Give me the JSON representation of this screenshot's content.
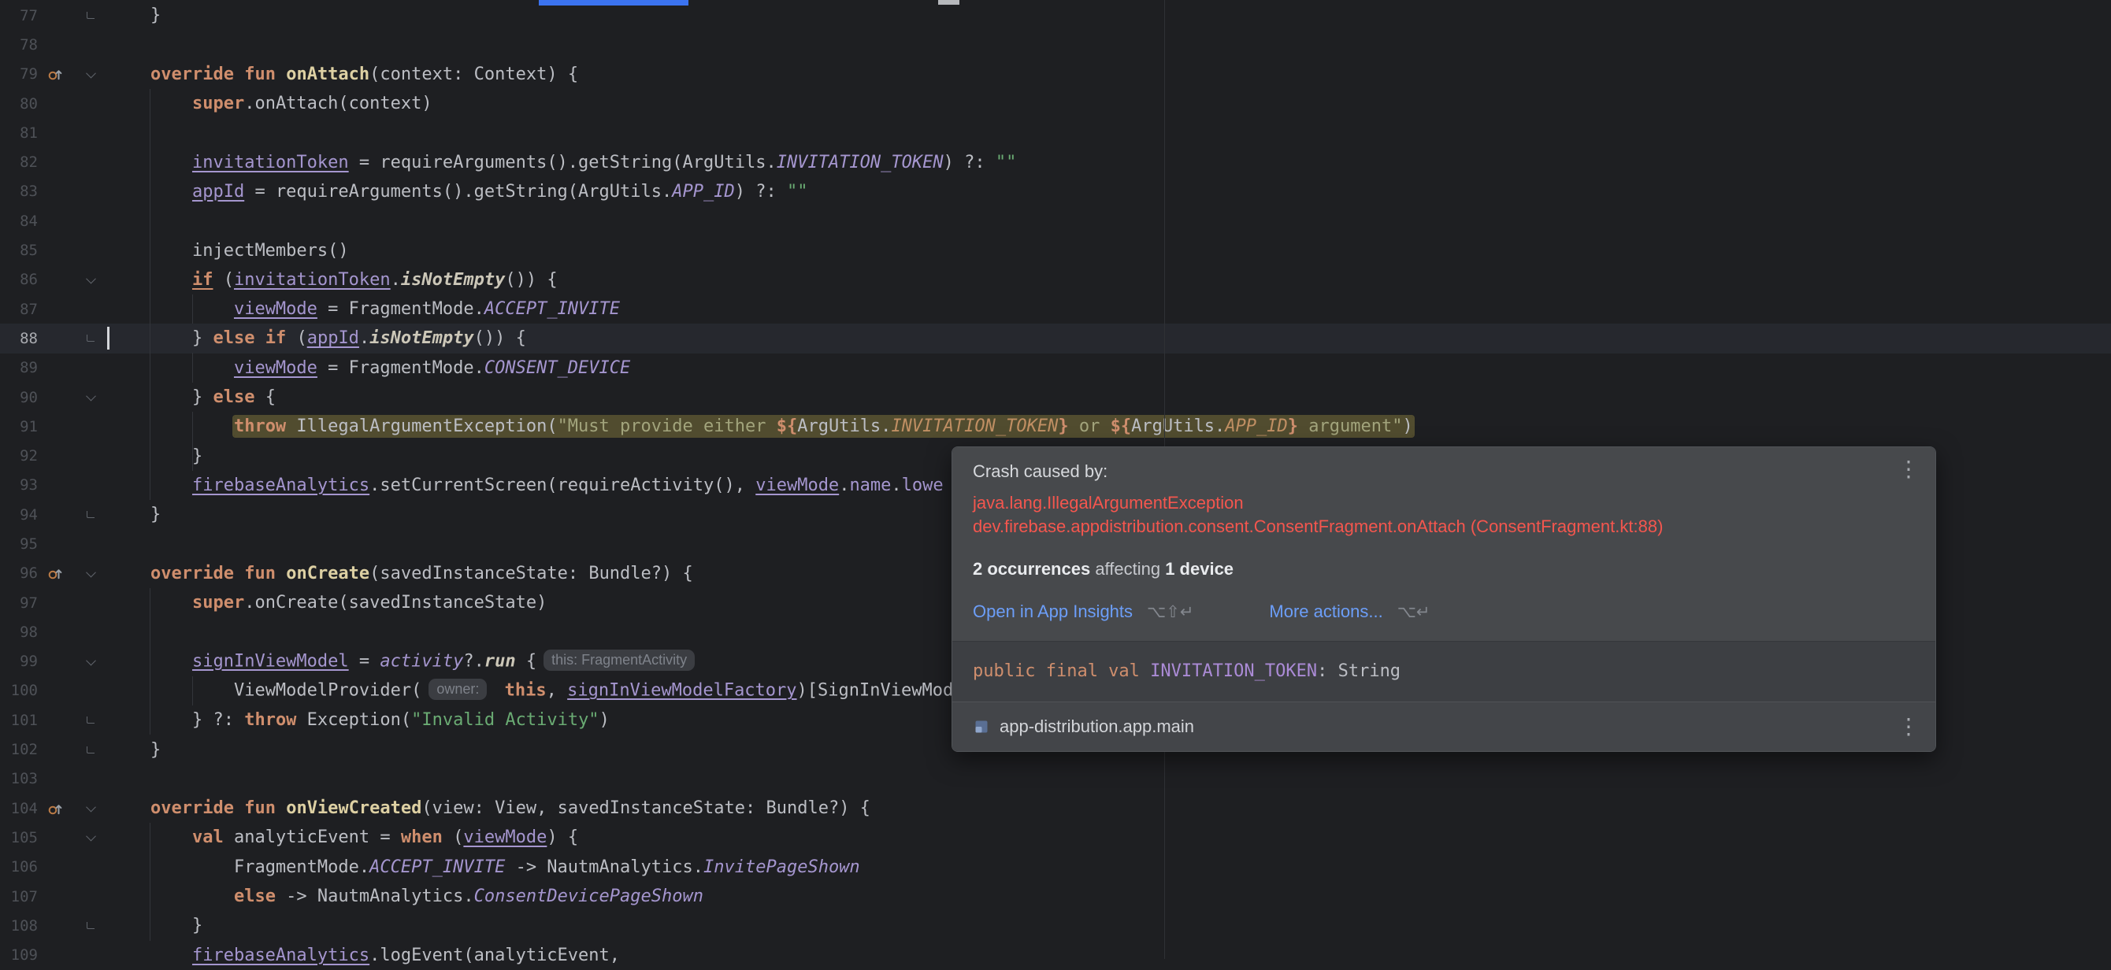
{
  "colors": {
    "editor_bg": "#1e1f22",
    "caret_line_bg": "#26282e",
    "crash_line_bg": "#514c2f",
    "error_red": "#f4564e",
    "link_blue": "#6c9ef8",
    "keyword_orange": "#cf8e6d",
    "string_green": "#6aab73",
    "property_purple": "#a596cf",
    "tab_indicator_blue": "#3b73f0"
  },
  "editor": {
    "caret": {
      "line": 88,
      "col": 0
    },
    "lines": [
      {
        "n": 77,
        "ind": 4,
        "fold": "end",
        "tokens": [
          [
            "}",
            "d"
          ]
        ]
      },
      {
        "n": 78
      },
      {
        "n": 79,
        "ind": 4,
        "icon": "override",
        "fold": "open",
        "tokens": [
          [
            "override",
            "k"
          ],
          [
            " ",
            "d"
          ],
          [
            "fun",
            "k"
          ],
          [
            " ",
            "d"
          ],
          [
            "onAttach",
            "f"
          ],
          [
            "(context: Context) {",
            "d"
          ]
        ]
      },
      {
        "n": 80,
        "ind": 8,
        "tokens": [
          [
            "super",
            "k"
          ],
          [
            ".onAttach(context)",
            "d"
          ]
        ]
      },
      {
        "n": 81
      },
      {
        "n": 82,
        "ind": 8,
        "tokens": [
          [
            "invitationToken",
            "p"
          ],
          [
            " = requireArguments().getString(ArgUtils.",
            "d"
          ],
          [
            "INVITATION_TOKEN",
            "c"
          ],
          [
            ") ?: ",
            "d"
          ],
          [
            "\"\"",
            "s"
          ]
        ]
      },
      {
        "n": 83,
        "ind": 8,
        "tokens": [
          [
            "appId",
            "p"
          ],
          [
            " = requireArguments().getString(ArgUtils.",
            "d"
          ],
          [
            "APP_ID",
            "c"
          ],
          [
            ") ?: ",
            "d"
          ],
          [
            "\"\"",
            "s"
          ]
        ]
      },
      {
        "n": 84
      },
      {
        "n": 85,
        "ind": 8,
        "tokens": [
          [
            "injectMembers()",
            "d"
          ]
        ]
      },
      {
        "n": 86,
        "ind": 8,
        "fold": "open",
        "tokens": [
          [
            "if",
            "ku"
          ],
          [
            " (",
            "d"
          ],
          [
            "invitationToken",
            "p"
          ],
          [
            ".",
            "d"
          ],
          [
            "isNotEmpty",
            "dbi"
          ],
          [
            "()) {",
            "d"
          ]
        ]
      },
      {
        "n": 87,
        "ind": 12,
        "tokens": [
          [
            "viewMode",
            "p"
          ],
          [
            " = FragmentMode.",
            "d"
          ],
          [
            "ACCEPT_INVITE",
            "c"
          ]
        ]
      },
      {
        "n": 88,
        "ind": 8,
        "fold": "end",
        "tokens": [
          [
            "} ",
            "d"
          ],
          [
            "else",
            "k"
          ],
          [
            " ",
            "d"
          ],
          [
            "if",
            "k"
          ],
          [
            " (",
            "d"
          ],
          [
            "appId",
            "p"
          ],
          [
            ".",
            "d"
          ],
          [
            "isNotEmpty",
            "dbi"
          ],
          [
            "()) {",
            "d"
          ]
        ]
      },
      {
        "n": 89,
        "ind": 12,
        "tokens": [
          [
            "viewMode",
            "p"
          ],
          [
            " = FragmentMode.",
            "d"
          ],
          [
            "CONSENT_DEVICE",
            "c"
          ]
        ]
      },
      {
        "n": 90,
        "ind": 8,
        "fold": "open",
        "tokens": [
          [
            "} ",
            "d"
          ],
          [
            "else",
            "k"
          ],
          [
            " {",
            "d"
          ]
        ]
      },
      {
        "n": 91,
        "ind": 12,
        "crash": true,
        "tokens": [
          [
            "throw",
            "k"
          ],
          [
            " IllegalArgumentException(",
            "d"
          ],
          [
            "\"Must provide either ",
            "sh"
          ],
          [
            "${",
            "k"
          ],
          [
            "ArgUtils.",
            "d"
          ],
          [
            "INVITATION_TOKEN",
            "ch"
          ],
          [
            "}",
            "k"
          ],
          [
            " or ",
            "sh"
          ],
          [
            "${",
            "k"
          ],
          [
            "ArgUtils.",
            "d"
          ],
          [
            "APP_ID",
            "ch"
          ],
          [
            "}",
            "k"
          ],
          [
            " argument\"",
            "sh"
          ],
          [
            ")",
            "d"
          ]
        ]
      },
      {
        "n": 92,
        "ind": 8,
        "tokens": [
          [
            "}",
            "d"
          ]
        ]
      },
      {
        "n": 93,
        "ind": 8,
        "tokens": [
          [
            "firebaseAnalytics",
            "p"
          ],
          [
            ".setCurrentScreen(requireActivity(), ",
            "d"
          ],
          [
            "viewMode",
            "p"
          ],
          [
            ".",
            "d"
          ],
          [
            "name",
            "pn"
          ],
          [
            ".",
            "d"
          ],
          [
            "lowe",
            "pn"
          ]
        ]
      },
      {
        "n": 94,
        "ind": 4,
        "fold": "end",
        "tokens": [
          [
            "}",
            "d"
          ]
        ]
      },
      {
        "n": 95
      },
      {
        "n": 96,
        "ind": 4,
        "icon": "override",
        "fold": "open",
        "tokens": [
          [
            "override",
            "k"
          ],
          [
            " ",
            "d"
          ],
          [
            "fun",
            "k"
          ],
          [
            " ",
            "d"
          ],
          [
            "onCreate",
            "f"
          ],
          [
            "(savedInstanceState: Bundle?) {",
            "d"
          ]
        ]
      },
      {
        "n": 97,
        "ind": 8,
        "tokens": [
          [
            "super",
            "k"
          ],
          [
            ".onCreate(savedInstanceState)",
            "d"
          ]
        ]
      },
      {
        "n": 98
      },
      {
        "n": 99,
        "ind": 8,
        "fold": "open",
        "tokens": [
          [
            "signInViewModel",
            "p"
          ],
          [
            " = ",
            "d"
          ],
          [
            "activity",
            "pi"
          ],
          [
            "?.",
            "d"
          ],
          [
            "run",
            "dbi"
          ],
          [
            " {",
            "d"
          ],
          [
            "this: FragmentActivity",
            "h"
          ]
        ]
      },
      {
        "n": 100,
        "ind": 12,
        "tokens": [
          [
            "ViewModelProvider(",
            "d"
          ],
          [
            "owner:",
            "h"
          ],
          [
            " ",
            "d"
          ],
          [
            "this",
            "k"
          ],
          [
            ", ",
            "d"
          ],
          [
            "signInViewModelFactory",
            "p"
          ],
          [
            ")[SignInViewMod",
            "d"
          ]
        ]
      },
      {
        "n": 101,
        "ind": 8,
        "fold": "end",
        "tokens": [
          [
            "} ?: ",
            "d"
          ],
          [
            "throw",
            "k"
          ],
          [
            " Exception(",
            "d"
          ],
          [
            "\"Invalid Activity\"",
            "s"
          ],
          [
            ")",
            "d"
          ]
        ]
      },
      {
        "n": 102,
        "ind": 4,
        "fold": "end",
        "tokens": [
          [
            "}",
            "d"
          ]
        ]
      },
      {
        "n": 103
      },
      {
        "n": 104,
        "ind": 4,
        "icon": "override",
        "fold": "open",
        "tokens": [
          [
            "override",
            "k"
          ],
          [
            " ",
            "d"
          ],
          [
            "fun",
            "k"
          ],
          [
            " ",
            "d"
          ],
          [
            "onViewCreated",
            "f"
          ],
          [
            "(view: View, savedInstanceState: Bundle?) {",
            "d"
          ]
        ]
      },
      {
        "n": 105,
        "ind": 8,
        "fold": "open",
        "tokens": [
          [
            "val",
            "k"
          ],
          [
            " analyticEvent = ",
            "d"
          ],
          [
            "when",
            "k"
          ],
          [
            " (",
            "d"
          ],
          [
            "viewMode",
            "p"
          ],
          [
            ") {",
            "d"
          ]
        ]
      },
      {
        "n": 106,
        "ind": 12,
        "tokens": [
          [
            "FragmentMode.",
            "d"
          ],
          [
            "ACCEPT_INVITE",
            "c"
          ],
          [
            " -> NautmAnalytics.",
            "d"
          ],
          [
            "InvitePageShown",
            "c"
          ]
        ]
      },
      {
        "n": 107,
        "ind": 12,
        "tokens": [
          [
            "else",
            "k"
          ],
          [
            " -> NautmAnalytics.",
            "d"
          ],
          [
            "ConsentDevicePageShown",
            "c"
          ]
        ]
      },
      {
        "n": 108,
        "ind": 8,
        "fold": "end",
        "tokens": [
          [
            "}",
            "d"
          ]
        ]
      },
      {
        "n": 109,
        "ind": 8,
        "tokens": [
          [
            "firebaseAnalytics",
            "p"
          ],
          [
            ".logEvent(analyticEvent, ",
            "d"
          ]
        ]
      }
    ]
  },
  "popup": {
    "caused_by": "Crash caused by:",
    "exception": "java.lang.IllegalArgumentException",
    "location": "dev.firebase.appdistribution.consent.ConsentFragment.onAttach (ConsentFragment.kt:88)",
    "occurrences": {
      "count": "2 occurrences",
      "middle": " affecting ",
      "devices": "1 device"
    },
    "actions": [
      {
        "label": "Open in App Insights",
        "shortcut": "⌥⇧↵"
      },
      {
        "label": "More actions...",
        "shortcut": "⌥↵"
      }
    ],
    "kebab_glyph": "⋮",
    "signature": {
      "modifiers": "public final val ",
      "name": "INVITATION_TOKEN",
      "type": ": String"
    },
    "module": "app-distribution.app.main"
  }
}
